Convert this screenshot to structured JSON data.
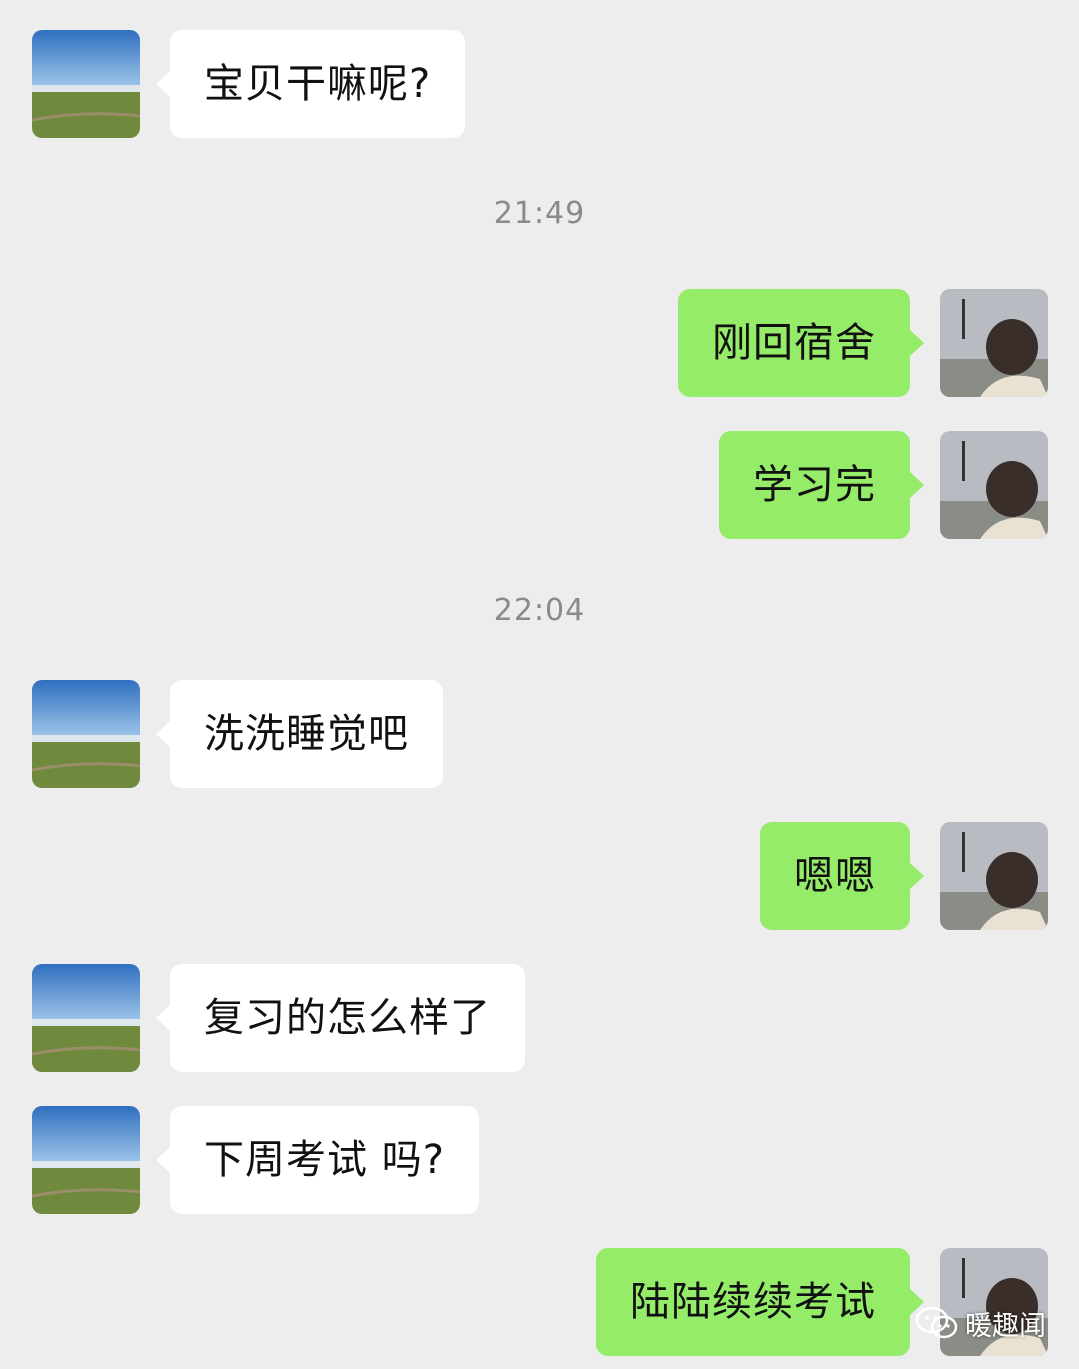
{
  "chat": {
    "messages": [
      {
        "type": "msg",
        "side": "left",
        "text": "宝贝干嘛呢?"
      },
      {
        "type": "time",
        "text": "21:49"
      },
      {
        "type": "msg",
        "side": "right",
        "text": "刚回宿舍"
      },
      {
        "type": "msg",
        "side": "right",
        "text": "学习完"
      },
      {
        "type": "time",
        "text": "22:04"
      },
      {
        "type": "msg",
        "side": "left",
        "text": "洗洗睡觉吧"
      },
      {
        "type": "msg",
        "side": "right",
        "text": "嗯嗯"
      },
      {
        "type": "msg",
        "side": "left",
        "text": "复习的怎么样了"
      },
      {
        "type": "msg",
        "side": "left",
        "text": "下周考试 吗?"
      },
      {
        "type": "msg",
        "side": "right",
        "text": "陆陆续续考试"
      }
    ]
  },
  "watermark": {
    "label": "暖趣闻",
    "icon": "wechat-icon"
  },
  "colors": {
    "background": "#ededed",
    "sent_bubble": "#95ec69",
    "received_bubble": "#ffffff",
    "time_text": "#8a8a8a"
  }
}
